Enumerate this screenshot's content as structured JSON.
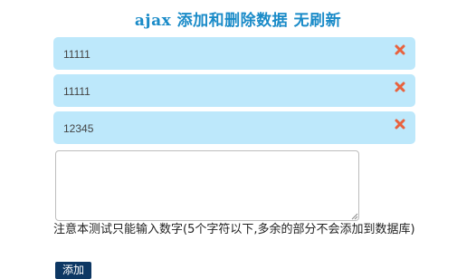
{
  "page": {
    "title": "ajax 添加和删除数据 无刷新"
  },
  "items": [
    {
      "text": "11111",
      "delete_icon": "close-x-icon"
    },
    {
      "text": "11111",
      "delete_icon": "close-x-icon"
    },
    {
      "text": "12345",
      "delete_icon": "close-x-icon"
    }
  ],
  "form": {
    "textarea_value": "",
    "hint": "注意本测试只能输入数字(5个字符以下,多余的部分不会添加到数据库)",
    "add_label": "添加"
  },
  "colors": {
    "title": "#1a8bc8",
    "item_bg": "#bde8fb",
    "delete_icon": "#e8623e",
    "button_bg": "#0d3763"
  }
}
